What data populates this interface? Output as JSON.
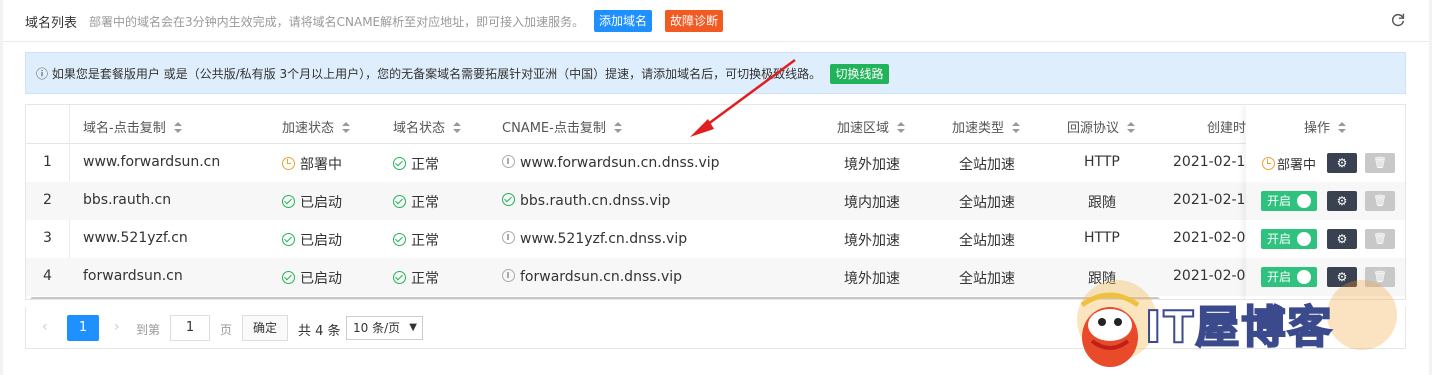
{
  "header": {
    "title": "域名列表",
    "description": "部署中的域名会在3分钟内生效完成，请将域名CNAME解析至对应地址，即可接入加速服务。",
    "add_button": "添加域名",
    "diagnose_button": "故障诊断",
    "refresh_icon": "refresh-icon"
  },
  "notice": {
    "text": "ⓘ 如果您是套餐版用户 或是（公共版/私有版 3个月以上用户），您的无备案域名需要拓展针对亚洲（中国）提速，请添加域名后，可切换极致线路。",
    "button": "切换线路"
  },
  "table": {
    "columns": [
      "域名-点击复制",
      "加速状态",
      "域名状态",
      "CNAME-点击复制",
      "加速区域",
      "加速类型",
      "回源协议",
      "创建时",
      "操作"
    ],
    "rows": [
      {
        "index": "1",
        "domain": "www.forwardsun.cn",
        "accel_status": "部署中",
        "accel_icon": "clock-icon",
        "domain_status": "正常",
        "cname": "www.forwardsun.cn.dnss.vip",
        "cname_icon": "info-icon",
        "region": "境外加速",
        "type": "全站加速",
        "protocol": "HTTP",
        "created": "2021-02-1",
        "op": "部署中"
      },
      {
        "index": "2",
        "domain": "bbs.rauth.cn",
        "accel_status": "已启动",
        "accel_icon": "check-icon",
        "domain_status": "正常",
        "cname": "bbs.rauth.cn.dnss.vip",
        "cname_icon": "check-icon",
        "region": "境内加速",
        "type": "全站加速",
        "protocol": "跟随",
        "created": "2021-02-1",
        "op": "开启"
      },
      {
        "index": "3",
        "domain": "www.521yzf.cn",
        "accel_status": "已启动",
        "accel_icon": "check-icon",
        "domain_status": "正常",
        "cname": "www.521yzf.cn.dnss.vip",
        "cname_icon": "info-icon",
        "region": "境外加速",
        "type": "全站加速",
        "protocol": "HTTP",
        "created": "2021-02-0",
        "op": "开启"
      },
      {
        "index": "4",
        "domain": "forwardsun.cn",
        "accel_status": "已启动",
        "accel_icon": "check-icon",
        "domain_status": "正常",
        "cname": "forwardsun.cn.dnss.vip",
        "cname_icon": "info-icon",
        "region": "境外加速",
        "type": "全站加速",
        "protocol": "跟随",
        "created": "2021-02-0",
        "op": "开启"
      }
    ]
  },
  "pager": {
    "prev": "‹",
    "current": "1",
    "next": "›",
    "goto_label": "到第",
    "goto_value": "1",
    "page_label": "页",
    "confirm": "确定",
    "total": "共 4 条",
    "page_size": "10 条/页"
  },
  "watermark": {
    "text": "IT屋博客"
  },
  "colors": {
    "primary": "#1e90ff",
    "danger": "#f15a22",
    "success": "#21b35a",
    "warning": "#f0a030"
  }
}
